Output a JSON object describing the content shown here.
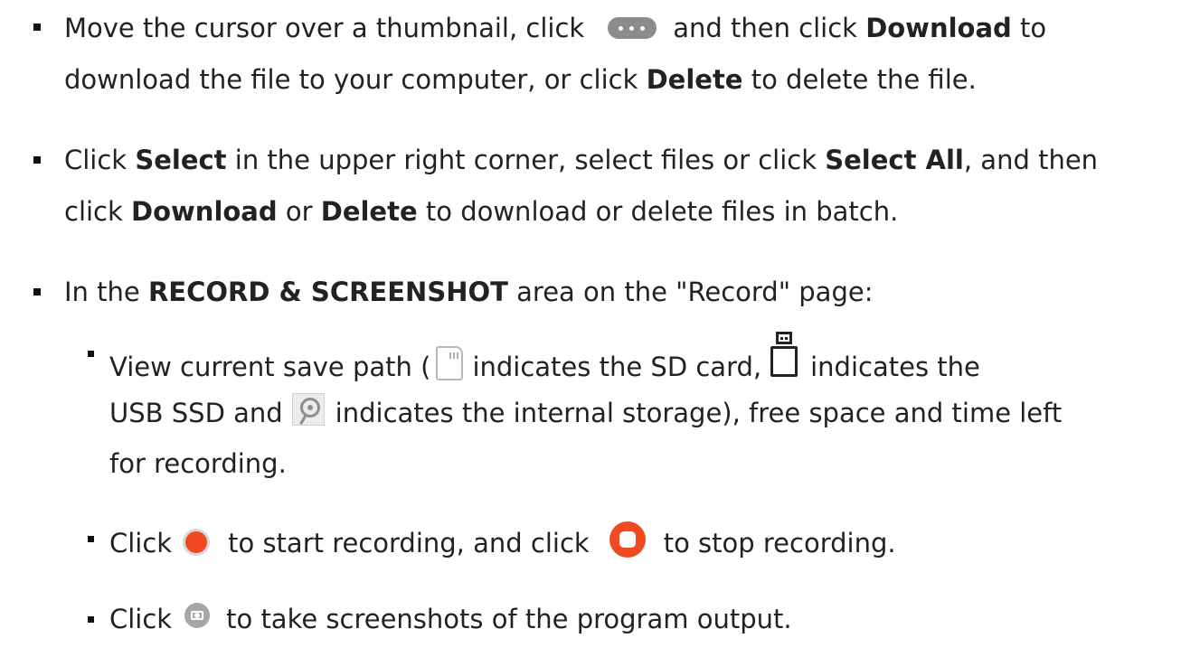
{
  "items": [
    {
      "l1_a": "Move the cursor over a thumbnail, click",
      "l1_b": "and then click",
      "l1_c": "Download",
      "l1_d": "to",
      "l2_a": "download the file to your computer, or click",
      "l2_b": "Delete",
      "l2_c": "to delete the file."
    },
    {
      "l1_a": "Click",
      "l1_b": "Select",
      "l1_c": "in the upper right corner, select files or click",
      "l1_d": "Select All",
      "l1_e": ", and then",
      "l2_a": "click",
      "l2_b": "Download",
      "l2_c": "or",
      "l2_d": "Delete",
      "l2_e": "to download or delete files in batch."
    },
    {
      "l1_a": "In the",
      "l1_b": "RECORD & SCREENSHOT",
      "l1_c": "area on the \"Record\" page:"
    }
  ],
  "subitems": [
    {
      "l1_a": "View current save path (",
      "l1_b": "indicates the SD card,",
      "l1_c": "indicates the",
      "l2_a": "USB SSD and",
      "l2_b": "indicates the internal storage), free space and time left",
      "l3_a": "for recording."
    },
    {
      "l1_a": "Click",
      "l1_b": "to start recording, and click",
      "l1_c": "to stop recording."
    },
    {
      "l1_a": "Click",
      "l1_b": "to take screenshots of the program output."
    }
  ],
  "icons": {
    "more": "more-options-icon",
    "sd": "sd-card-icon",
    "usb": "usb-ssd-icon",
    "hdd": "internal-storage-icon",
    "record": "record-icon",
    "stop": "stop-icon",
    "camera": "screenshot-icon"
  },
  "colors": {
    "record_red": "#f14a22",
    "text": "#222222"
  }
}
